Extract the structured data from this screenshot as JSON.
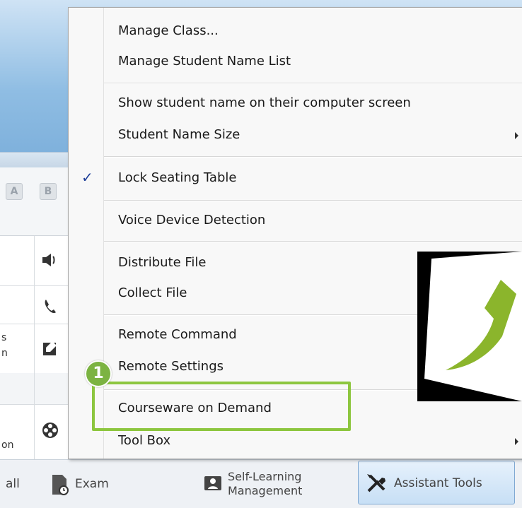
{
  "menu": {
    "items": [
      {
        "label": "Manage Class..."
      },
      {
        "label": "Manage Student Name List"
      },
      {
        "label": "Show student name on their computer screen"
      },
      {
        "label": "Student Name Size",
        "submenu": true
      },
      {
        "label": "Lock Seating Table",
        "checked": true
      },
      {
        "label": "Voice Device Detection"
      },
      {
        "label": "Distribute File"
      },
      {
        "label": "Collect File"
      },
      {
        "label": "Remote Command"
      },
      {
        "label": "Remote Settings"
      },
      {
        "label": "Courseware on Demand",
        "highlighted": true
      },
      {
        "label": "Tool Box",
        "submenu": true
      }
    ],
    "check_mark": "✓"
  },
  "callout": {
    "number": "1",
    "color": "#8dc63f"
  },
  "background": {
    "seat_buttons": [
      "A",
      "B"
    ],
    "side_text": [
      "s",
      "n",
      "on"
    ],
    "icons": [
      "speaker-icon",
      "phone-icon",
      "edit-icon",
      "film-reel-icon"
    ]
  },
  "toolbar": {
    "all_label": "all",
    "exam_label": "Exam",
    "self_learning_line1": "Self-Learning",
    "self_learning_line2": "Management",
    "assistant_label": "Assistant Tools"
  }
}
